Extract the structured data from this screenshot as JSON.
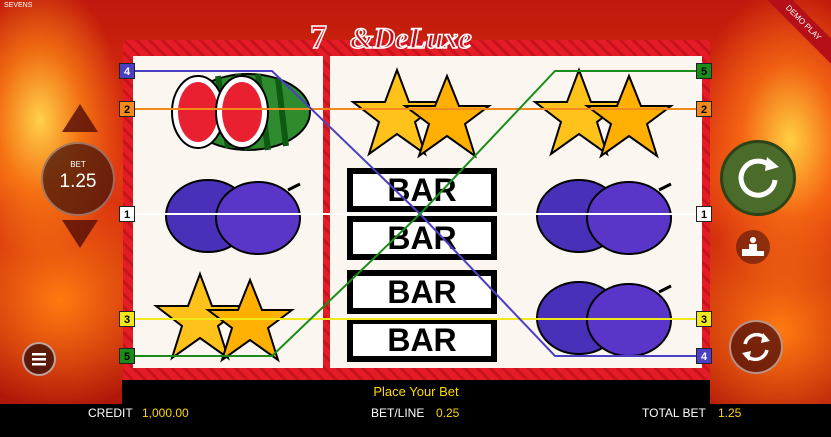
{
  "game_title": "SEVENS",
  "demo_label": "DEMO PLAY",
  "bet": {
    "label": "BET",
    "value": "1.25"
  },
  "reels": [
    [
      "watermelon",
      "plum",
      "stars"
    ],
    [
      "stars",
      "bar-bar",
      "bar-bar"
    ],
    [
      "stars",
      "plum",
      "plum"
    ]
  ],
  "bar_text": "BAR",
  "paylines": [
    {
      "number": "1",
      "color": "#ffffff"
    },
    {
      "number": "2",
      "color": "#f28a1c"
    },
    {
      "number": "3",
      "color": "#f0e81a"
    },
    {
      "number": "4",
      "color": "#4b3fc4"
    },
    {
      "number": "5",
      "color": "#1a8c1a"
    }
  ],
  "message": "Place Your Bet",
  "bottom": {
    "credit_label": "CREDIT",
    "credit_value": "1,000.00",
    "betline_label": "BET/LINE",
    "betline_value": "0.25",
    "total_label": "TOTAL BET",
    "total_value": "1.25"
  },
  "colors": {
    "frame": "#e31c26",
    "message_text": "#ffd800",
    "spin_button": "#4a6b2a"
  }
}
